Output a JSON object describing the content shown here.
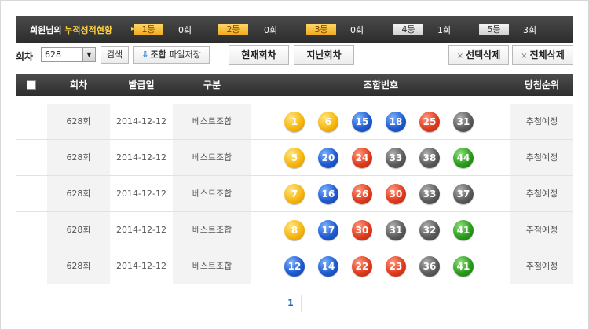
{
  "summary": {
    "title_prefix": "회원님의 ",
    "title_highlight": "누적성적현황",
    "arrow": "▸",
    "ranks": [
      {
        "label": "1등",
        "count": "0회",
        "style": "gold"
      },
      {
        "label": "2등",
        "count": "0회",
        "style": "gold"
      },
      {
        "label": "3등",
        "count": "0회",
        "style": "gold"
      },
      {
        "label": "4등",
        "count": "1회",
        "style": "grey"
      },
      {
        "label": "5등",
        "count": "3회",
        "style": "grey"
      }
    ]
  },
  "toolbar": {
    "round_label": "회차",
    "round_value": "628",
    "dropdown_icon": "▼",
    "search_label": "검색",
    "save_label_bold": "조합",
    "save_label_rest": " 파일저장",
    "save_icon": "download-icon",
    "current_round_label": "현재회차",
    "past_round_label": "지난회차",
    "delete_selected_label": "선택삭제",
    "delete_all_label": "전체삭제",
    "delete_icon_glyph": "×"
  },
  "table": {
    "headers": {
      "round": "회차",
      "issue_date": "발급일",
      "type": "구분",
      "numbers": "조합번호",
      "rank": "당첨순위"
    },
    "rows": [
      {
        "round": "628회",
        "date": "2014-12-12",
        "type": "베스트조합",
        "rank": "추첨예정",
        "balls": [
          {
            "n": "1",
            "c": "yellow"
          },
          {
            "n": "6",
            "c": "yellow"
          },
          {
            "n": "15",
            "c": "blue"
          },
          {
            "n": "18",
            "c": "blue"
          },
          {
            "n": "25",
            "c": "red"
          },
          {
            "n": "31",
            "c": "grey"
          }
        ]
      },
      {
        "round": "628회",
        "date": "2014-12-12",
        "type": "베스트조합",
        "rank": "추첨예정",
        "balls": [
          {
            "n": "5",
            "c": "yellow"
          },
          {
            "n": "20",
            "c": "blue"
          },
          {
            "n": "24",
            "c": "red"
          },
          {
            "n": "33",
            "c": "grey"
          },
          {
            "n": "38",
            "c": "grey"
          },
          {
            "n": "44",
            "c": "green"
          }
        ]
      },
      {
        "round": "628회",
        "date": "2014-12-12",
        "type": "베스트조합",
        "rank": "추첨예정",
        "balls": [
          {
            "n": "7",
            "c": "yellow"
          },
          {
            "n": "16",
            "c": "blue"
          },
          {
            "n": "26",
            "c": "red"
          },
          {
            "n": "30",
            "c": "red"
          },
          {
            "n": "33",
            "c": "grey"
          },
          {
            "n": "37",
            "c": "grey"
          }
        ]
      },
      {
        "round": "628회",
        "date": "2014-12-12",
        "type": "베스트조합",
        "rank": "추첨예정",
        "balls": [
          {
            "n": "8",
            "c": "yellow"
          },
          {
            "n": "17",
            "c": "blue"
          },
          {
            "n": "30",
            "c": "red"
          },
          {
            "n": "31",
            "c": "grey"
          },
          {
            "n": "32",
            "c": "grey"
          },
          {
            "n": "41",
            "c": "green"
          }
        ]
      },
      {
        "round": "628회",
        "date": "2014-12-12",
        "type": "베스트조합",
        "rank": "추첨예정",
        "balls": [
          {
            "n": "12",
            "c": "blue"
          },
          {
            "n": "14",
            "c": "blue"
          },
          {
            "n": "22",
            "c": "red"
          },
          {
            "n": "23",
            "c": "red"
          },
          {
            "n": "36",
            "c": "grey"
          },
          {
            "n": "41",
            "c": "green"
          }
        ]
      }
    ]
  },
  "pager": {
    "current": "1"
  },
  "colors": {
    "header_bg": "#2e2e2e",
    "highlight": "#ffd23c",
    "ball_yellow": "#f7b70f",
    "ball_blue": "#1f5bd0",
    "ball_red": "#e03c1e",
    "ball_grey": "#5c5c5c",
    "ball_green": "#2b9d1c",
    "pager_active": "#1a5fb4"
  }
}
